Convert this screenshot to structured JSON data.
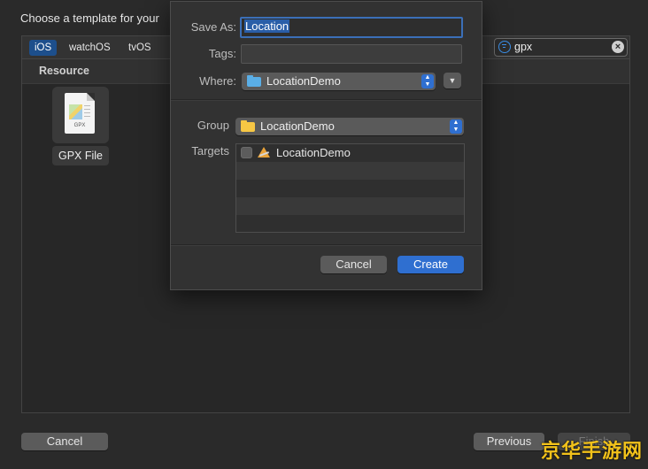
{
  "chooser": {
    "title": "Choose a template for your",
    "platforms": [
      "iOS",
      "watchOS",
      "tvOS"
    ],
    "selected_platform": "iOS",
    "search": {
      "value": "gpx"
    },
    "section": "Resource",
    "templates": [
      {
        "name": "GPX File",
        "icon": "gpx-file-icon",
        "icon_text": "GPX"
      }
    ],
    "buttons": {
      "cancel": "Cancel",
      "previous": "Previous",
      "finish": "Finish"
    }
  },
  "save_sheet": {
    "save_as_label": "Save As:",
    "save_as_value": "Location",
    "tags_label": "Tags:",
    "tags_value": "",
    "where_label": "Where:",
    "where_value": "LocationDemo",
    "group_label": "Group",
    "group_value": "LocationDemo",
    "targets_label": "Targets",
    "targets": [
      {
        "name": "LocationDemo",
        "checked": false,
        "icon": "app-target-icon"
      }
    ],
    "cancel_label": "Cancel",
    "create_label": "Create"
  },
  "colors": {
    "accent": "#2f6fd0",
    "folder_blue": "#5aaee6",
    "folder_yellow": "#f7c744",
    "watermark": "#f2c21b"
  },
  "watermark": "京华手游网"
}
